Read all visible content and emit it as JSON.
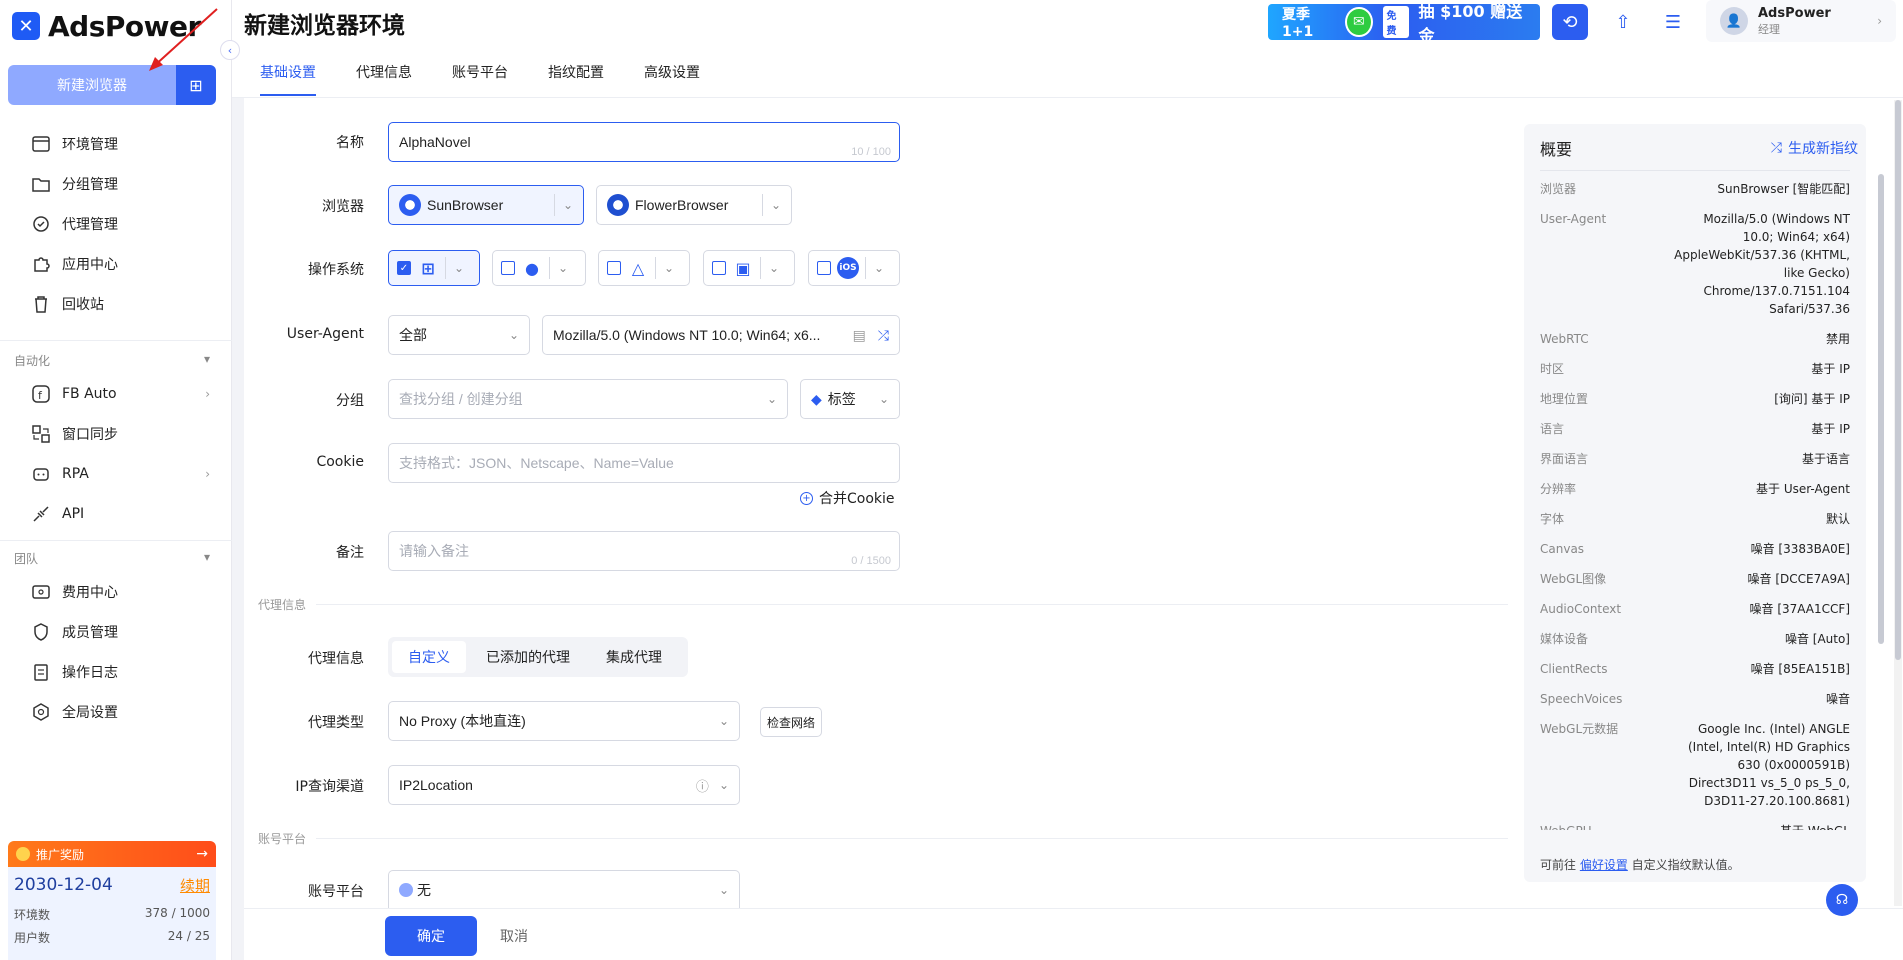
{
  "app": {
    "name": "AdsPower"
  },
  "sidebar": {
    "new_browser_label": "新建浏览器",
    "items": [
      {
        "label": "环境管理",
        "icon": "window-icon"
      },
      {
        "label": "分组管理",
        "icon": "folder-icon"
      },
      {
        "label": "代理管理",
        "icon": "proxy-icon"
      },
      {
        "label": "应用中心",
        "icon": "puzzle-icon"
      },
      {
        "label": "回收站",
        "icon": "trash-icon"
      }
    ],
    "automation_section": "自动化",
    "automation_items": [
      {
        "label": "FB Auto",
        "icon": "fb-icon"
      },
      {
        "label": "窗口同步",
        "icon": "sync-icon"
      },
      {
        "label": "RPA",
        "icon": "robot-icon"
      },
      {
        "label": "API",
        "icon": "api-icon"
      }
    ],
    "team_section": "团队",
    "team_items": [
      {
        "label": "费用中心",
        "icon": "billing-icon"
      },
      {
        "label": "成员管理",
        "icon": "shield-icon"
      },
      {
        "label": "操作日志",
        "icon": "log-icon"
      },
      {
        "label": "全局设置",
        "icon": "settings-icon"
      }
    ],
    "promo_label": "推广奖励",
    "subscription": {
      "expiry": "2030-12-04",
      "renew_label": "续期",
      "env_label": "环境数",
      "env_value": "378 / 1000",
      "user_label": "用户数",
      "user_value": "24 / 25"
    }
  },
  "header": {
    "title": "新建浏览器环境",
    "banner": {
      "left": "夏季1+1",
      "free": "免费",
      "right": "抽 $100 赠送金"
    },
    "user": {
      "name": "AdsPower",
      "role": "经理"
    }
  },
  "tabs": [
    "基础设置",
    "代理信息",
    "账号平台",
    "指纹配置",
    "高级设置"
  ],
  "form": {
    "name_label": "名称",
    "name_value": "AlphaNovel",
    "name_count": "10 / 100",
    "browser_label": "浏览器",
    "browser_1": "SunBrowser",
    "browser_2": "FlowerBrowser",
    "os_label": "操作系统",
    "os_ios": "iOS",
    "ua_label": "User-Agent",
    "ua_filter": "全部",
    "ua_value": "Mozilla/5.0 (Windows NT 10.0; Win64; x6...",
    "group_label": "分组",
    "group_placeholder": "查找分组 / 创建分组",
    "tag_label": "标签",
    "cookie_label": "Cookie",
    "cookie_placeholder": "支持格式：JSON、Netscape、Name=Value",
    "merge_cookie": "合并Cookie",
    "note_label": "备注",
    "note_placeholder": "请输入备注",
    "note_count": "0 / 1500",
    "proxy_section": "代理信息",
    "proxy_info_label": "代理信息",
    "proxy_options": [
      "自定义",
      "已添加的代理",
      "集成代理"
    ],
    "proxy_type_label": "代理类型",
    "proxy_type_value": "No Proxy (本地直连)",
    "check_network": "检查网络",
    "ip_channel_label": "IP查询渠道",
    "ip_channel_value": "IP2Location",
    "account_section": "账号平台",
    "account_label": "账号平台",
    "account_value": "无"
  },
  "footer": {
    "ok": "确定",
    "cancel": "取消"
  },
  "summary": {
    "title": "概要",
    "generate": "生成新指纹",
    "rows": [
      {
        "k": "浏览器",
        "v": "SunBrowser [智能匹配]"
      },
      {
        "k": "User-Agent",
        "v": "Mozilla/5.0 (Windows NT 10.0; Win64; x64) AppleWebKit/537.36 (KHTML, like Gecko) Chrome/137.0.7151.104 Safari/537.36"
      },
      {
        "k": "WebRTC",
        "v": "禁用"
      },
      {
        "k": "时区",
        "v": "基于 IP"
      },
      {
        "k": "地理位置",
        "v": "[询问] 基于 IP"
      },
      {
        "k": "语言",
        "v": "基于 IP"
      },
      {
        "k": "界面语言",
        "v": "基于语言"
      },
      {
        "k": "分辨率",
        "v": "基于 User-Agent"
      },
      {
        "k": "字体",
        "v": "默认"
      },
      {
        "k": "Canvas",
        "v": "噪音 [3383BA0E]"
      },
      {
        "k": "WebGL图像",
        "v": "噪音 [DCCE7A9A]"
      },
      {
        "k": "AudioContext",
        "v": "噪音 [37AA1CCF]"
      },
      {
        "k": "媒体设备",
        "v": "噪音 [Auto]"
      },
      {
        "k": "ClientRects",
        "v": "噪音 [85EA151B]"
      },
      {
        "k": "SpeechVoices",
        "v": "噪音"
      },
      {
        "k": "WebGL元数据",
        "v": "Google Inc. (Intel) ANGLE (Intel, Intel(R) HD Graphics 630 (0x0000591B) Direct3D11 vs_5_0 ps_5_0, D3D11-27.20.100.8681)"
      },
      {
        "k": "WebGPU",
        "v": "基于 WebGL"
      }
    ],
    "foot_prefix": "可前往 ",
    "foot_link": "偏好设置",
    "foot_suffix": " 自定义指纹默认值。"
  },
  "colors": {
    "primary": "#2c5df0",
    "promo": "#ff6a1a"
  }
}
